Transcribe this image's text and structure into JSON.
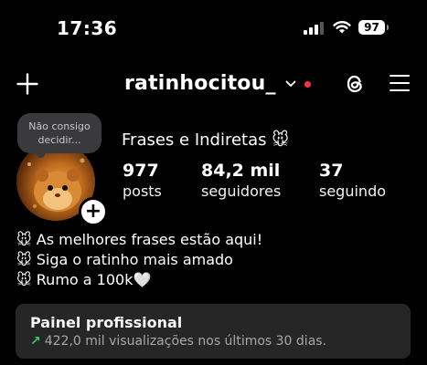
{
  "status_bar": {
    "time": "17:36",
    "battery": "97"
  },
  "header": {
    "username": "ratinhocitou_",
    "has_notification_dot": true,
    "icons": [
      "plus-icon",
      "chevron-down-icon",
      "threads-icon",
      "menu-icon"
    ]
  },
  "profile": {
    "note": "Não consigo decidir...",
    "display_name": "Frases e Indiretas 🐭",
    "stats": [
      {
        "value": "977",
        "label": "posts"
      },
      {
        "value": "84,2 mil",
        "label": "seguidores"
      },
      {
        "value": "37",
        "label": "seguindo"
      }
    ],
    "bio": [
      "🐭 As melhores frases estão aqui!",
      "🐭 Siga o ratinho mais amado",
      "🐭 Rumo a 100k🤍"
    ]
  },
  "dashboard": {
    "title": "Painel profissional",
    "stats_text": "422,0 mil visualizações nos últimos 30 dias.",
    "trend_icon": "↗"
  },
  "colors": {
    "background": "#000000",
    "notification_dot": "#ff3040",
    "dashboard_bg": "#262626",
    "trend_green": "#3cc46b"
  }
}
